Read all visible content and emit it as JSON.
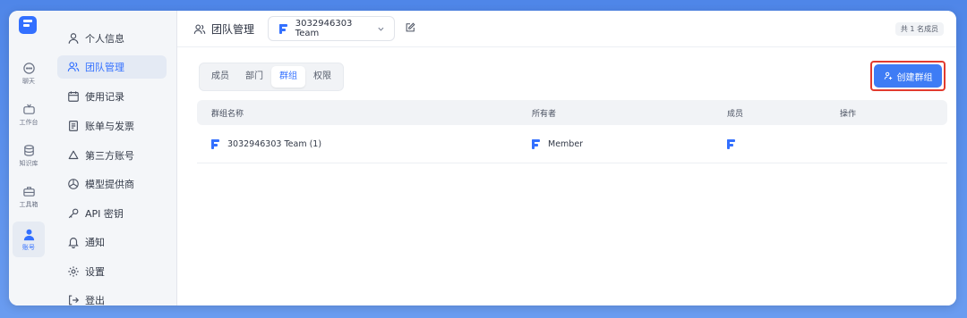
{
  "rail": {
    "items": [
      {
        "label": "聊天",
        "icon": "chat-icon"
      },
      {
        "label": "工作台",
        "icon": "tv-icon"
      },
      {
        "label": "知识库",
        "icon": "database-icon"
      },
      {
        "label": "工具箱",
        "icon": "toolbox-icon"
      },
      {
        "label": "账号",
        "icon": "user-icon"
      }
    ]
  },
  "sidebar": {
    "items": [
      {
        "label": "个人信息",
        "icon": "user-icon"
      },
      {
        "label": "团队管理",
        "icon": "team-icon"
      },
      {
        "label": "使用记录",
        "icon": "calendar-icon"
      },
      {
        "label": "账单与发票",
        "icon": "receipt-icon"
      },
      {
        "label": "第三方账号",
        "icon": "triangle-icon"
      },
      {
        "label": "模型提供商",
        "icon": "openai-icon"
      },
      {
        "label": "API 密钥",
        "icon": "key-icon"
      },
      {
        "label": "通知",
        "icon": "bell-icon"
      },
      {
        "label": "设置",
        "icon": "gear-icon"
      },
      {
        "label": "登出",
        "icon": "logout-icon"
      }
    ]
  },
  "header": {
    "title": "团队管理",
    "team_name": "3032946303 Team",
    "member_count": "共 1 名成员"
  },
  "tabs": [
    "成员",
    "部门",
    "群组",
    "权限"
  ],
  "create_button": "创建群组",
  "table": {
    "headers": [
      "群组名称",
      "所有者",
      "成员",
      "操作"
    ],
    "rows": [
      {
        "name": "3032946303 Team  (1)",
        "owner": "Member"
      }
    ]
  },
  "colors": {
    "accent": "#3370ff",
    "highlight_border": "#e23b2e"
  }
}
